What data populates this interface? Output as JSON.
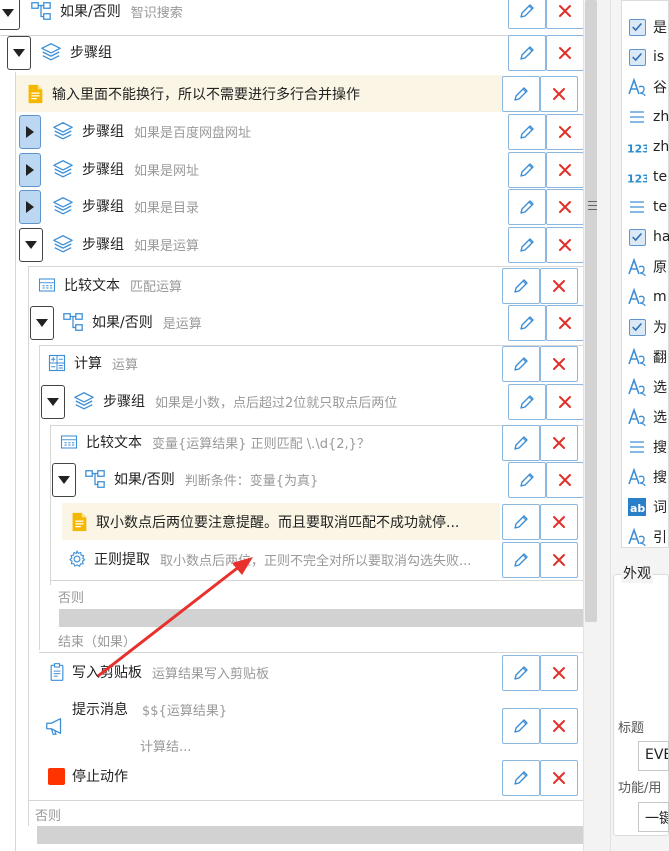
{
  "tree": {
    "r0": {
      "title": "如果/否则",
      "sub": "智识搜索"
    },
    "r1": {
      "title": "步骤组",
      "sub": ""
    },
    "note1": {
      "text": "输入里面不能换行，所以不需要进行多行合并操作"
    },
    "r2": {
      "title": "步骤组",
      "sub": "如果是百度网盘网址"
    },
    "r3": {
      "title": "步骤组",
      "sub": "如果是网址"
    },
    "r4": {
      "title": "步骤组",
      "sub": "如果是目录"
    },
    "r5": {
      "title": "步骤组",
      "sub": "如果是运算"
    },
    "r6": {
      "title": "比较文本",
      "sub": "匹配运算"
    },
    "r7": {
      "title": "如果/否则",
      "sub": "是运算"
    },
    "r8": {
      "title": "计算",
      "sub": "运算"
    },
    "r9": {
      "title": "步骤组",
      "sub": "如果是小数，点后超过2位就只取点后两位"
    },
    "r10": {
      "title": "比较文本",
      "sub": "变量{运算结果} 正则匹配  \\.\\d{2,}？"
    },
    "r11": {
      "title": "如果/否则",
      "sub": "判断条件：变量{为真}"
    },
    "note2": {
      "text": "取小数点后两位要注意提醒。而且要取消匹配不成功就停..."
    },
    "r12": {
      "title": "正则提取",
      "sub": "取小数点后两位，正则不完全对所以要取消勾选失败..."
    },
    "else1": "否则",
    "end1": "结束（如果）",
    "r13": {
      "title": "写入剪贴板",
      "sub": "运算结果写入剪贴板"
    },
    "r14": {
      "title": "提示消息",
      "sub": "$${运算结果}",
      "sub2": "计算结..."
    },
    "r15": {
      "title": "停止动作"
    },
    "else2": "否则"
  },
  "right_panel": {
    "items": [
      {
        "icon": "checkbox-icon",
        "text": "是"
      },
      {
        "icon": "checkbox-icon",
        "text": "is"
      },
      {
        "icon": "text-abc-icon",
        "text": "谷"
      },
      {
        "icon": "list-icon",
        "text": "zh"
      },
      {
        "icon": "number-123-icon",
        "text": "zh"
      },
      {
        "icon": "number-123-icon",
        "text": "te"
      },
      {
        "icon": "list-icon",
        "text": "te"
      },
      {
        "icon": "checkbox-icon",
        "text": "ha"
      },
      {
        "icon": "text-abc-icon",
        "text": "原"
      },
      {
        "icon": "text-abc-icon",
        "text": "m"
      },
      {
        "icon": "checkbox-icon",
        "text": "为"
      },
      {
        "icon": "text-abc-icon",
        "text": "翻"
      },
      {
        "icon": "text-abc-icon",
        "text": "选"
      },
      {
        "icon": "text-abc-icon",
        "text": "选"
      },
      {
        "icon": "list-icon",
        "text": "搜"
      },
      {
        "icon": "text-abc-icon",
        "text": "搜"
      },
      {
        "icon": "ab-icon",
        "text": "词"
      },
      {
        "icon": "text-abc-icon",
        "text": "引"
      }
    ],
    "appearance_label": "外观",
    "title_label": "标题",
    "title_value": "EVE",
    "function_label": "功能/用",
    "function_value": "一键"
  },
  "colors": {
    "accent_blue": "#3d8fd6",
    "delete_red": "#e0302a",
    "note_bg": "#faf5e4",
    "stop_red": "#ff3300"
  }
}
